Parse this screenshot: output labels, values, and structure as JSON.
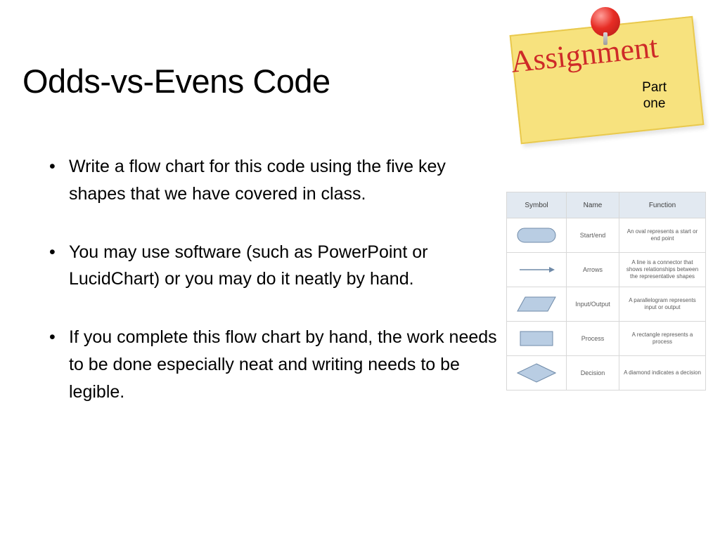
{
  "title": "Odds-vs-Evens Code",
  "note": {
    "label": "Assignment",
    "part_line1": "Part",
    "part_line2": "one"
  },
  "bullets": [
    "Write a flow chart for this code using the five key shapes that we have covered in class.",
    "You may use software (such as PowerPoint or LucidChart) or you may do it neatly by hand.",
    "If you complete this flow chart by hand, the work needs to be done especially neat and writing needs to be legible."
  ],
  "legend": {
    "headers": {
      "symbol": "Symbol",
      "name": "Name",
      "function": "Function"
    },
    "rows": [
      {
        "shape": "terminator",
        "name": "Start/end",
        "function": "An oval represents a start or end point"
      },
      {
        "shape": "arrow",
        "name": "Arrows",
        "function": "A line is a connector that shows relationships between the representative shapes"
      },
      {
        "shape": "io",
        "name": "Input/Output",
        "function": "A parallelogram represents input or output"
      },
      {
        "shape": "process",
        "name": "Process",
        "function": "A rectangle represents a process"
      },
      {
        "shape": "decision",
        "name": "Decision",
        "function": "A diamond indicates a decision"
      }
    ]
  }
}
